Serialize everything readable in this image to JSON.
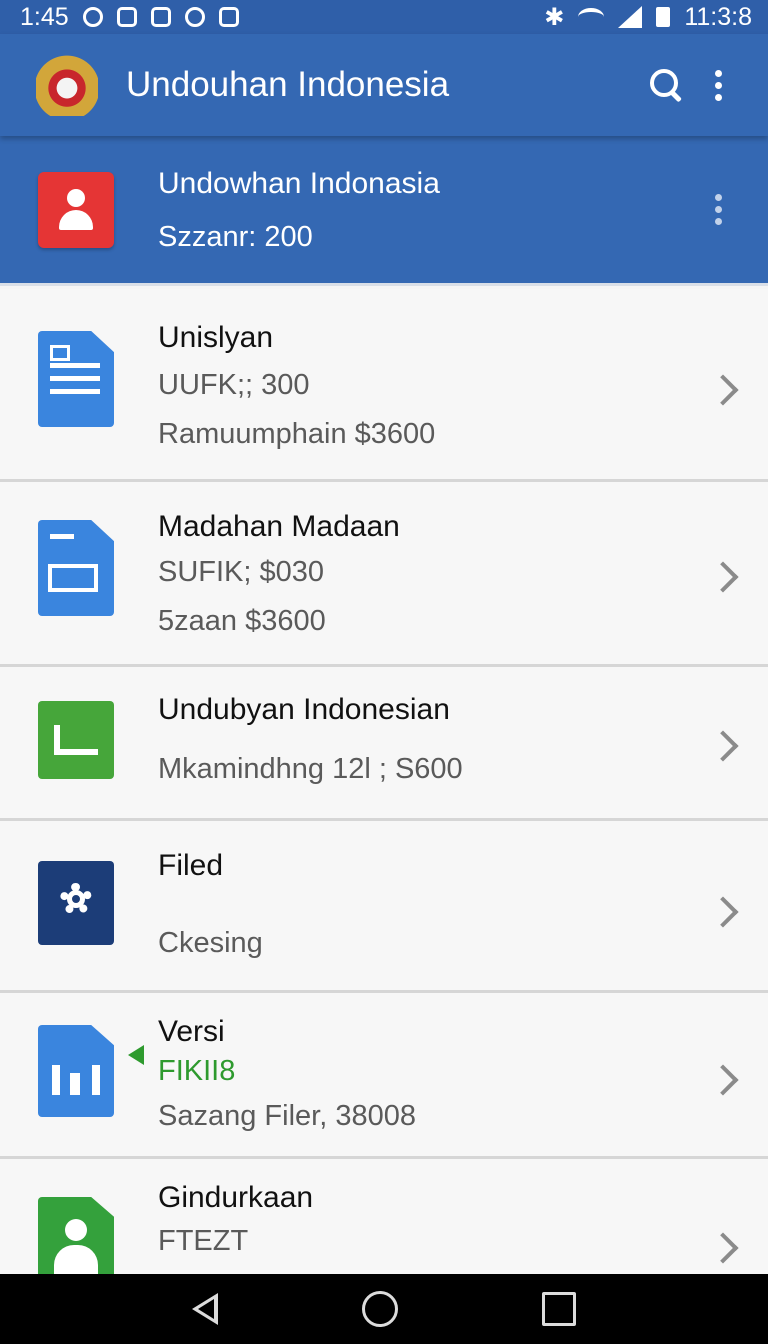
{
  "status_bar": {
    "time": "1:45",
    "clock_right": "11:3:8",
    "icons": [
      "sync-icon",
      "data-icon",
      "sd-card-icon",
      "shield-icon",
      "camera-icon",
      "bluetooth-icon",
      "wifi-icon",
      "signal-icon",
      "battery-icon"
    ]
  },
  "app_bar": {
    "title": "Undouhan Indonesia",
    "logo": "garuda-emblem-logo",
    "actions": [
      "search-icon",
      "more-vert-icon"
    ]
  },
  "header_card": {
    "title": "Undowhan Indonasia",
    "subtitle": "Szzanr: 200",
    "icon": "contact-icon",
    "accent": "#e53535"
  },
  "items": [
    {
      "title": "Unislyan",
      "line1": "UUFK;; 300",
      "line2": "Ramuumphain $3600",
      "icon": "document-icon"
    },
    {
      "title": "Madahan Madaan",
      "line1": "SUFIK; $030",
      "line2": "5zaan $3600",
      "icon": "slides-icon"
    },
    {
      "title": "Undubyan Indonesian",
      "line1": "Mkamindhng 12l ; S600",
      "icon": "video-icon"
    },
    {
      "title": "Filed",
      "line1": "Ckesing",
      "icon": "settings-gear-icon"
    },
    {
      "title": "Versi",
      "line1": "FIKII8",
      "line2": "Sazang Filer, 38008",
      "icon": "chart-icon",
      "accent": "#2e9a2e"
    },
    {
      "title": "Gindurkaan",
      "line1": "FTEZT",
      "icon": "contact-doc-icon"
    }
  ],
  "nav_bar": {
    "buttons": [
      "back-icon",
      "home-icon",
      "recents-icon"
    ]
  },
  "colors": {
    "primary": "#3468b3",
    "status_bar": "#2f5fa9",
    "background": "#f7f7f7"
  }
}
